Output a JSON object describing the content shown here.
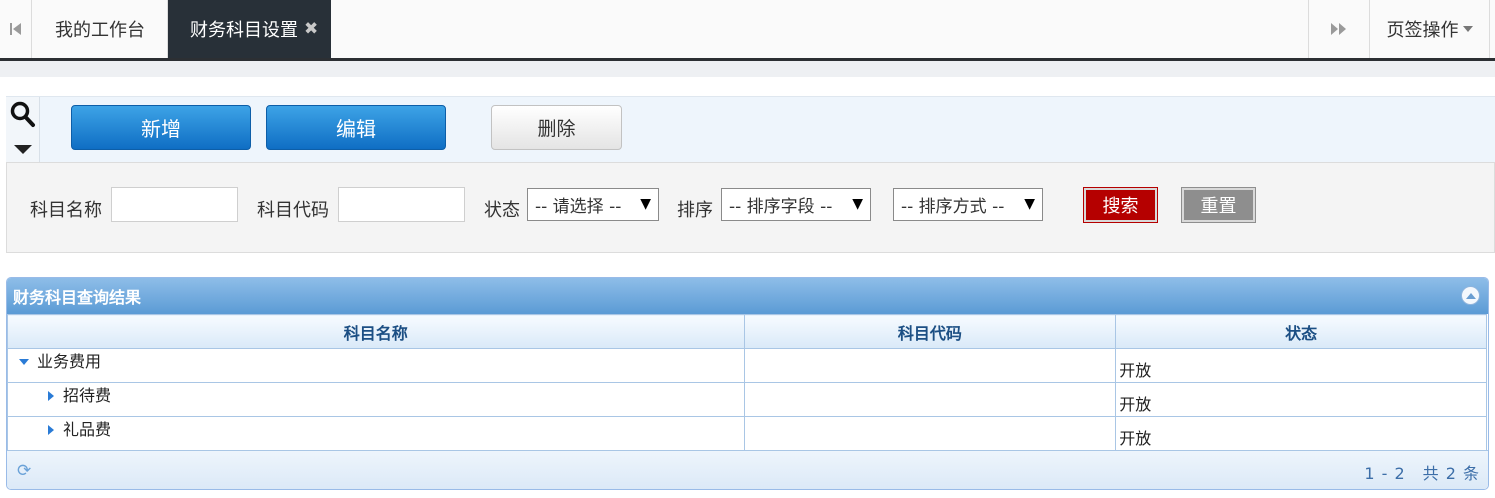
{
  "tabs": {
    "home_label": "我的工作台",
    "active_label": "财务科目设置",
    "close_glyph": "✖",
    "ops_label": "页签操作",
    "prev_icon": "first-page-icon",
    "next_icon": "fast-forward-icon"
  },
  "toolbar": {
    "add_label": "新增",
    "edit_label": "编辑",
    "delete_label": "删除",
    "search_icon": "search-icon"
  },
  "search": {
    "subject_name_label": "科目名称",
    "subject_name_value": "",
    "subject_code_label": "科目代码",
    "subject_code_value": "",
    "status_label": "状态",
    "status_selected": "-- 请选择 --",
    "sort_label": "排序",
    "sort_field_selected": "-- 排序字段 --",
    "sort_order_selected": "-- 排序方式 --",
    "search_button": "搜索",
    "reset_button": "重置"
  },
  "grid": {
    "title": "财务科目查询结果",
    "columns": [
      "科目名称",
      "科目代码",
      "状态"
    ],
    "rows": [
      {
        "name": "业务费用",
        "code": "",
        "status": "开放",
        "level": 0,
        "expanded": true
      },
      {
        "name": "招待费",
        "code": "",
        "status": "开放",
        "level": 1,
        "expanded": false
      },
      {
        "name": "礼品费",
        "code": "",
        "status": "开放",
        "level": 1,
        "expanded": false
      }
    ],
    "pager_text": "1 - 2　共 2 条",
    "refresh_icon": "refresh-icon"
  },
  "colors": {
    "accent_blue": "#0f6ec4",
    "search_red": "#b50000",
    "active_tab": "#283038",
    "grid_header": "#5b9bd5"
  }
}
